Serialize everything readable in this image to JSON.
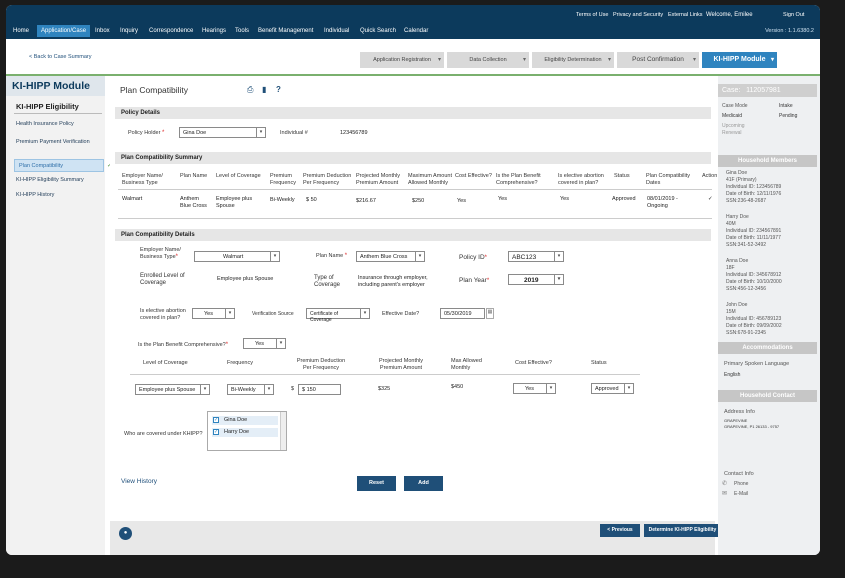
{
  "utility": {
    "terms": "Terms of Use",
    "privacy": "Privacy and Security",
    "external": "External Links",
    "welcome": "Welcome, Emilee",
    "signout": "Sign Out"
  },
  "nav": {
    "items": [
      "Home",
      "Application/Case",
      "Inbox",
      "Inquiry",
      "Correspondence",
      "Hearings",
      "Tools",
      "Benefit Management",
      "Individual",
      "Quick Search",
      "Calendar"
    ],
    "version": "Version : 1.1.6380.2"
  },
  "subbar": {
    "back": "< Back to Case Summary",
    "steps": [
      "Application Registration",
      "Data Collection",
      "Eligibility Determination",
      "Post Confirmation"
    ],
    "active_step": "KI-HIPP Module"
  },
  "sidebar": {
    "module": "KI-HIPP Module",
    "section": "KI-HIPP Eligibility",
    "links": [
      "Health Insurance Policy",
      "Premium Payment Verification"
    ],
    "selected": "Plan Compatibility",
    "links2": [
      "KI-HIPP Eligibility Summary",
      "KI-HIPP History"
    ]
  },
  "page": {
    "title": "Plan Compatibility"
  },
  "policy": {
    "header": "Policy Details",
    "holder_label": "Policy Holder",
    "holder_value": "Gina Doe",
    "individual_label": "Individual #",
    "individual_value": "123456789"
  },
  "summary": {
    "header": "Plan Compatibility Summary",
    "columns": [
      "Employer Name/ Business Type",
      "Plan Name",
      "Level of Coverage",
      "Premium Frequency",
      "Premium Deduction Per Frequency",
      "Projected Monthly Premium Amount",
      "Maximum Amount Allowed Monthly",
      "Cost Effective?",
      "Is the Plan Benefit Comprehensive?",
      "Is elective abortion covered in plan?",
      "Status",
      "Plan Compatibility Dates",
      "Action"
    ],
    "row": [
      "Walmart",
      "Anthem Blue Cross",
      "Employee plus Spouse",
      "Bi-Weekly",
      "$ 50",
      "$216.67",
      "$250",
      "Yes",
      "Yes",
      "Yes",
      "Approved",
      "08/01/2019 - Ongoing",
      "✓"
    ]
  },
  "details": {
    "header": "Plan Compatibility Details",
    "employer_label": "Employer Name/ Business Type",
    "employer_value": "Walmart",
    "plan_label": "Plan Name",
    "plan_value": "Anthem Blue Cross",
    "policy_id_label": "Policy ID",
    "policy_id_value": "ABC123",
    "enrolled_label": "Enrolled Level of Coverage",
    "enrolled_value": "Employee plus Spouse",
    "type_label": "Type of Coverage",
    "type_value": "Insurance through employer, including parent's employer",
    "year_label": "Plan Year",
    "year_value": "2019",
    "abortion_label": "Is elective abortion covered in plan?",
    "abortion_value": "Yes",
    "verif_label": "Verification Source",
    "verif_value": "Certificate of Coverage",
    "eff_label": "Effective Date?",
    "eff_value": "05/30/2019",
    "comp_label": "Is the Plan Benefit Comprehensive?",
    "comp_value": "Yes",
    "grid_cols": [
      "Level of Coverage",
      "Frequency",
      "Premium Deduction Per Frequency",
      "Projected Monthly Premium Amount",
      "Max Allowed Monthly",
      "Cost Effective?",
      "Status"
    ],
    "grid_row": {
      "level": "Employee plus Spouse",
      "freq": "Bi-Weekly",
      "prem": "$ 150",
      "proj": "$325",
      "max": "$450",
      "cost": "Yes",
      "status": "Approved"
    },
    "covered_label": "Who are covered under KHIPP?",
    "covered": [
      "Gina Doe",
      "Harry Doe"
    ]
  },
  "links": {
    "view_history": "View History"
  },
  "buttons": {
    "reset": "Reset",
    "add": "Add",
    "previous": "< Previous",
    "determine": "Determine KI-HIPP Eligibility"
  },
  "right": {
    "case_label": "Case:",
    "case_value": "112057981",
    "case_mode": "Case Mode",
    "intake": "Intake",
    "medicaid": "Medicaid",
    "pending": "Pending",
    "upcoming": "Upcoming Renewal",
    "household_head": "Household Members",
    "members": [
      [
        "Gina Doe",
        "41F (Primary)",
        "Individual ID: 123456789",
        "Date of Birth: 12/11/1976",
        "SSN:236-48-2687"
      ],
      [
        "Harry Doe",
        "40M",
        "Individual ID: 234567891",
        "Date of Birth: 11/11/1977",
        "SSN:341-52-3492"
      ],
      [
        "Anna Doe",
        "18F",
        "Individual ID: 345678912",
        "Date of Birth: 10/10/2000",
        "SSN:456-12-3456"
      ],
      [
        "John Doe",
        "15M",
        "Individual ID: 456789123",
        "Date of Birth: 09/09/2002",
        "SSN:678-91-2345"
      ]
    ],
    "accom_head": "Accommodations",
    "lang_label": "Primary Spoken Language",
    "lang_value": "English",
    "contact_head": "Household Contact",
    "address_label": "Address Info",
    "address_line1": "GRAPEVINE",
    "address_line2": "GRAPEVINE, P1 26133 - 9757",
    "contact_info": "Contact Info",
    "phone": "Phone",
    "email": "E-Mail"
  }
}
